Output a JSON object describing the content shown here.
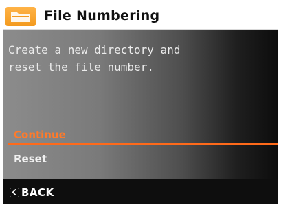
{
  "title_bar": {
    "icon": "file-folder-icon",
    "title": "File Numbering",
    "accent_color": "#f7a12d"
  },
  "content": {
    "description_line_1": "Create a new directory and",
    "description_line_2": "reset the file number."
  },
  "options": {
    "items": [
      {
        "label": "Continue",
        "selected": true
      },
      {
        "label": "Reset",
        "selected": false
      }
    ],
    "selected_color": "#ff7a2a"
  },
  "footer": {
    "back_icon": "back-arrow-icon",
    "back_label": "BACK"
  }
}
